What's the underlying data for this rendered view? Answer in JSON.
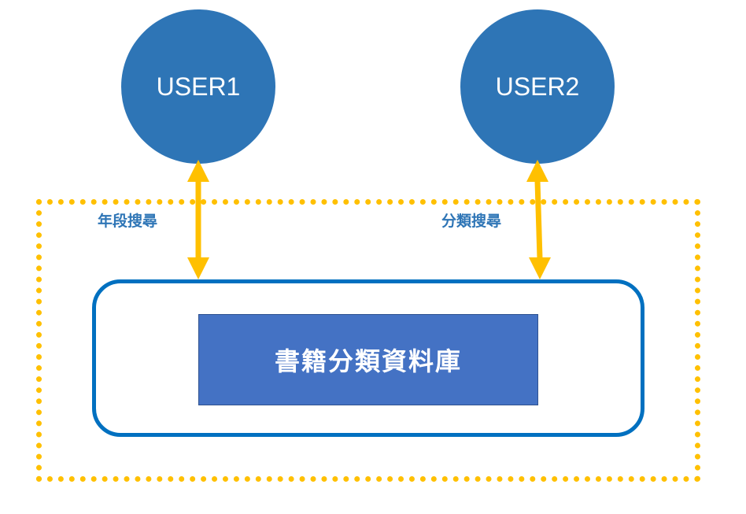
{
  "users": [
    {
      "label": "USER1"
    },
    {
      "label": "USER2"
    }
  ],
  "links": [
    {
      "label": "年段搜尋"
    },
    {
      "label": "分類搜尋"
    }
  ],
  "database": {
    "label": "書籍分類資料庫"
  },
  "colors": {
    "user_fill": "#2E75B6",
    "arrow": "#FFC000",
    "boundary": "#FFC000",
    "container_border": "#0070C0",
    "db_fill": "#4472C4",
    "label_text": "#2E75B6"
  }
}
